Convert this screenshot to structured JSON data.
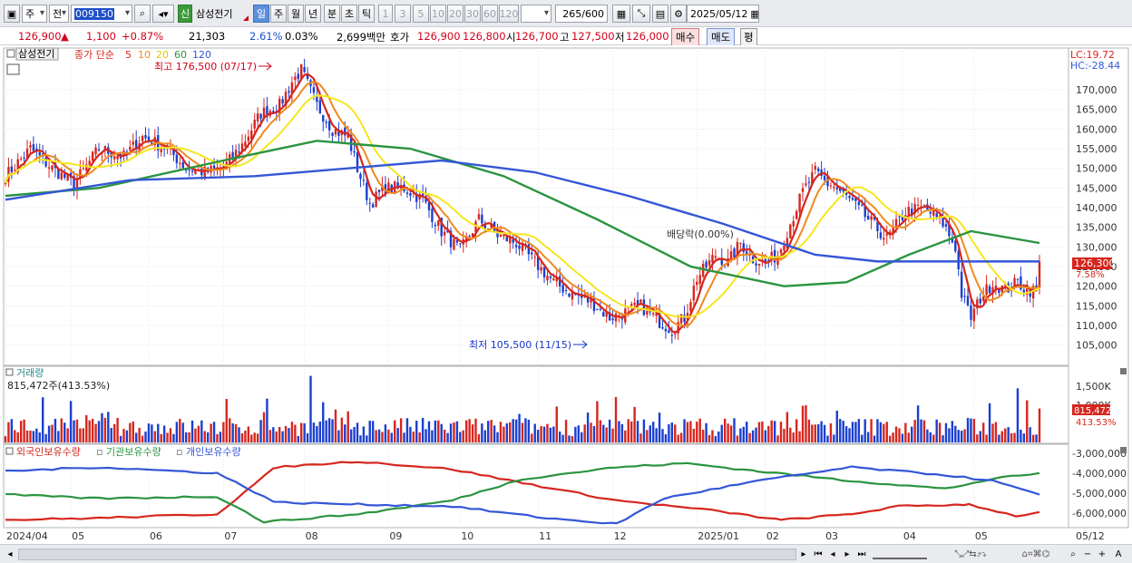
{
  "toolbar": {
    "type_select": "주",
    "market_select": "전",
    "code": "009150",
    "badge": "신",
    "name": "삼성전기",
    "periods": [
      "일",
      "주",
      "월",
      "년",
      "분",
      "초",
      "틱"
    ],
    "active_period": "일",
    "intervals": [
      "1",
      "3",
      "5",
      "10",
      "20",
      "30",
      "60",
      "120"
    ],
    "count": "265",
    "count_max": "/600",
    "date": "2025/05/12"
  },
  "quote": {
    "price": "126,900",
    "arrow": "▲",
    "change": "1,100",
    "change_pct": "+0.87%",
    "volume": "21,303",
    "ratio1": "2.61%",
    "ratio2": "0.03%",
    "amount": "2,699백만",
    "bid_label": "호가",
    "bid1": "126,900",
    "bid2": "126,800",
    "open_label": "시",
    "open": "126,700",
    "high_label": "고",
    "high": "127,500",
    "low_label": "저",
    "low": "126,000",
    "buy_label": "매수",
    "sell_label": "매도",
    "avg_label": "평"
  },
  "price_panel": {
    "tab": "삼성전기",
    "legend_prefix": "종가 단순",
    "ma_periods": [
      "5",
      "10",
      "20",
      "60",
      "120"
    ],
    "ma_colors": [
      "#d6261e",
      "#ef8a1e",
      "#f5e61e",
      "#2b9440",
      "#3456d6"
    ],
    "lc": "LC:19.72",
    "hc": "HC:-28.44",
    "high_note": "최고 176,500 (07/17)",
    "low_note": "최저 105,500 (11/15)",
    "dividend_note": "배당락(0.00%)",
    "current_price_tag": "126,300",
    "current_pct_tag": "7.58%"
  },
  "volume_panel": {
    "title": "거래량",
    "subtitle": "815,472주(413.53%)",
    "axis": [
      "1,500K",
      "1,000K"
    ],
    "current_tag": "815,472",
    "current_pct": "413.53%"
  },
  "holding_panel": {
    "legend": [
      "외국인보유수량",
      "기관보유수량",
      "개인보유수량"
    ],
    "legend_colors": [
      "#d6261e",
      "#2b9440",
      "#3456d6"
    ],
    "axis": [
      "-3,000,000",
      "-4,000,000",
      "-5,000,000",
      "-6,000,000"
    ]
  },
  "x_axis": {
    "labels": [
      "2024/04",
      "05",
      "06",
      "07",
      "08",
      "09",
      "10",
      "11",
      "12",
      "2025/01",
      "02",
      "03",
      "04",
      "05"
    ],
    "right_label": "05/12"
  },
  "chart_data": {
    "type": "candlestick",
    "y_price_ticks": [
      105000,
      110000,
      115000,
      120000,
      125000,
      130000,
      135000,
      140000,
      145000,
      150000,
      155000,
      160000,
      165000,
      170000
    ],
    "y_price_tick_labels": [
      "105,000",
      "110,000",
      "115,000",
      "120,000",
      "125,000",
      "130,000",
      "135,000",
      "140,000",
      "145,000",
      "150,000",
      "155,000",
      "160,000",
      "165,000",
      "170,000"
    ],
    "ylim_price": [
      101000,
      179000
    ],
    "session_count": 265,
    "close_anchors": [
      [
        0,
        148000
      ],
      [
        8,
        155000
      ],
      [
        15,
        150000
      ],
      [
        22,
        146000
      ],
      [
        30,
        155000
      ],
      [
        38,
        153000
      ],
      [
        44,
        158000
      ],
      [
        52,
        155000
      ],
      [
        58,
        150000
      ],
      [
        64,
        149000
      ],
      [
        70,
        150000
      ],
      [
        76,
        156000
      ],
      [
        82,
        164000
      ],
      [
        88,
        166000
      ],
      [
        92,
        172000
      ],
      [
        95,
        175000
      ],
      [
        100,
        166000
      ],
      [
        105,
        160000
      ],
      [
        110,
        158000
      ],
      [
        113,
        150000
      ],
      [
        117,
        141000
      ],
      [
        122,
        145000
      ],
      [
        128,
        145000
      ],
      [
        134,
        142000
      ],
      [
        140,
        134000
      ],
      [
        146,
        129000
      ],
      [
        152,
        137000
      ],
      [
        158,
        133000
      ],
      [
        164,
        131000
      ],
      [
        170,
        126000
      ],
      [
        176,
        121000
      ],
      [
        182,
        118000
      ],
      [
        188,
        116000
      ],
      [
        194,
        112000
      ],
      [
        198,
        113000
      ],
      [
        204,
        115000
      ],
      [
        210,
        111000
      ],
      [
        214,
        109000
      ],
      [
        218,
        112000
      ],
      [
        222,
        122000
      ],
      [
        228,
        128000
      ],
      [
        232,
        126000
      ],
      [
        236,
        131000
      ],
      [
        240,
        127000
      ],
      [
        244,
        126000
      ],
      [
        248,
        128000
      ],
      [
        252,
        136000
      ],
      [
        256,
        144000
      ],
      [
        260,
        149000
      ],
      [
        264,
        146000
      ]
    ],
    "close_anchors_2025": [
      [
        0,
        146000
      ],
      [
        6,
        142000
      ],
      [
        12,
        137000
      ],
      [
        18,
        132000
      ],
      [
        24,
        139000
      ],
      [
        30,
        140000
      ],
      [
        36,
        136000
      ],
      [
        40,
        130000
      ],
      [
        42,
        118000
      ],
      [
        45,
        112000
      ],
      [
        48,
        117000
      ],
      [
        52,
        121000
      ],
      [
        56,
        119000
      ],
      [
        60,
        121000
      ],
      [
        63,
        119000
      ],
      [
        66,
        119000
      ],
      [
        67,
        126300
      ]
    ],
    "ma120": [
      [
        0,
        142000
      ],
      [
        40,
        147000
      ],
      [
        80,
        148000
      ],
      [
        110,
        150000
      ],
      [
        140,
        152000
      ],
      [
        170,
        149000
      ],
      [
        200,
        143000
      ],
      [
        230,
        136000
      ],
      [
        260,
        128000
      ],
      [
        280,
        126300
      ],
      [
        332,
        126300
      ]
    ],
    "ma60": [
      [
        0,
        143000
      ],
      [
        30,
        145000
      ],
      [
        70,
        152000
      ],
      [
        100,
        157000
      ],
      [
        130,
        155000
      ],
      [
        160,
        148000
      ],
      [
        190,
        137000
      ],
      [
        220,
        125000
      ],
      [
        250,
        120000
      ],
      [
        270,
        121000
      ],
      [
        290,
        128000
      ],
      [
        310,
        134000
      ],
      [
        332,
        131000
      ]
    ],
    "holding": {
      "ylim": [
        -6600000,
        -2700000
      ],
      "foreign": [
        [
          0,
          -6300000
        ],
        [
          40,
          -6200000
        ],
        [
          90,
          -6000000
        ],
        [
          115,
          -3600000
        ],
        [
          150,
          -3300000
        ],
        [
          190,
          -3700000
        ],
        [
          220,
          -4400000
        ],
        [
          260,
          -5300000
        ],
        [
          300,
          -5800000
        ],
        [
          330,
          -6300000
        ],
        [
          360,
          -6000000
        ],
        [
          380,
          -5600000
        ],
        [
          410,
          -5500000
        ],
        [
          430,
          -6100000
        ],
        [
          440,
          -5900000
        ]
      ],
      "institution": [
        [
          0,
          -5000000
        ],
        [
          40,
          -5200000
        ],
        [
          90,
          -5100000
        ],
        [
          110,
          -6400000
        ],
        [
          150,
          -6000000
        ],
        [
          190,
          -5300000
        ],
        [
          220,
          -4200000
        ],
        [
          260,
          -3600000
        ],
        [
          290,
          -3400000
        ],
        [
          320,
          -3800000
        ],
        [
          360,
          -4300000
        ],
        [
          400,
          -4700000
        ],
        [
          420,
          -4200000
        ],
        [
          440,
          -3900000
        ]
      ],
      "individual": [
        [
          0,
          -3800000
        ],
        [
          40,
          -3600000
        ],
        [
          90,
          -3900000
        ],
        [
          115,
          -5400000
        ],
        [
          150,
          -5500000
        ],
        [
          190,
          -5600000
        ],
        [
          230,
          -6200000
        ],
        [
          260,
          -6500000
        ],
        [
          280,
          -5200000
        ],
        [
          320,
          -4300000
        ],
        [
          360,
          -3600000
        ],
        [
          400,
          -4000000
        ],
        [
          420,
          -4300000
        ],
        [
          440,
          -5000000
        ]
      ]
    },
    "volume_ylim": [
      0,
      1700000
    ],
    "volume_last": 815472
  }
}
